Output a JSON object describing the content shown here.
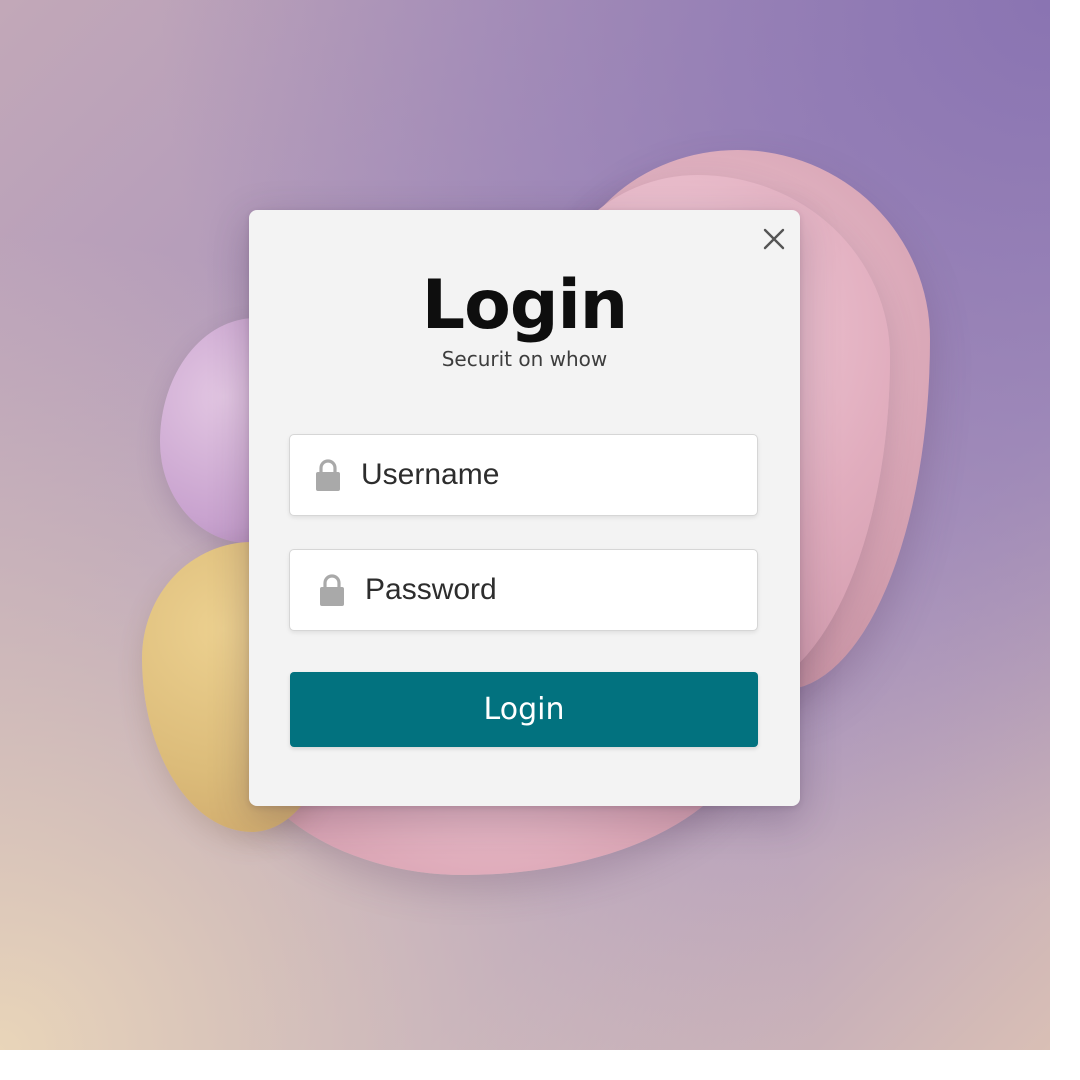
{
  "dialog": {
    "title": "Login",
    "subtitle": "Securit on whow",
    "close_icon": "close-icon"
  },
  "fields": {
    "username": {
      "placeholder": "Username",
      "icon": "lock-icon"
    },
    "password": {
      "placeholder": "Password",
      "icon": "lock-icon"
    }
  },
  "button": {
    "label": "Login"
  },
  "colors": {
    "button_bg": "#02727f",
    "card_bg": "#f3f3f3",
    "icon_gray": "#a9a9a9",
    "background_purple": "#8a74b2",
    "background_peach": "#e9d5b9"
  }
}
